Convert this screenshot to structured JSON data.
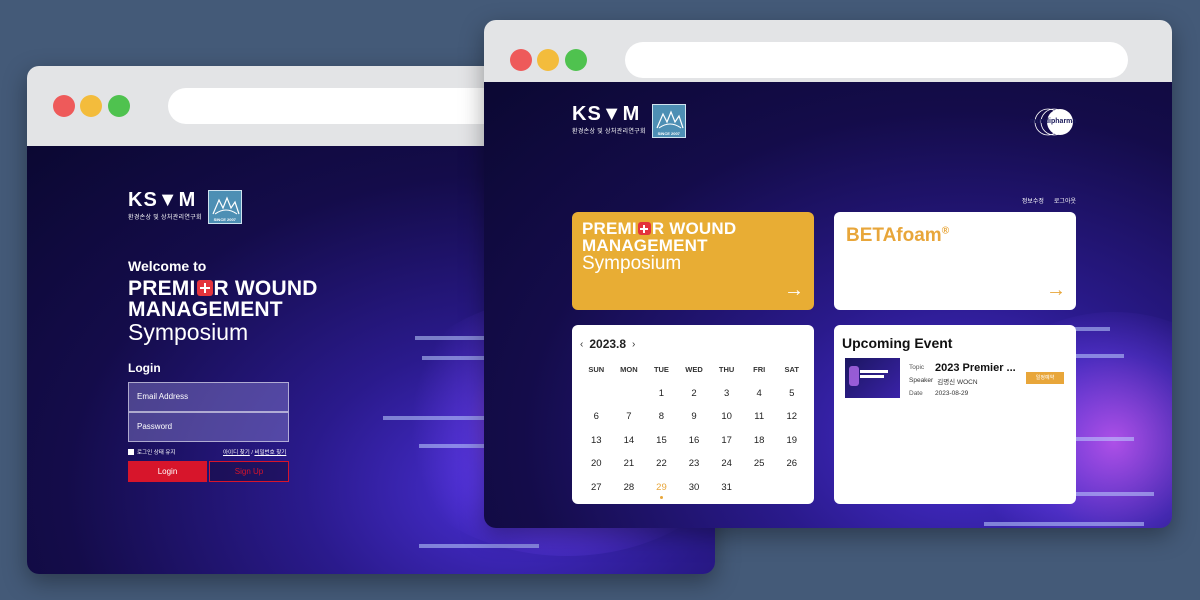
{
  "login_window": {
    "logo": {
      "main": "KS▼M",
      "sub": "환경손상 및 상처관리연구회",
      "badge": "SINCE 2007"
    },
    "welcome": "Welcome to",
    "symposium": {
      "line1a": "PREMI",
      "line1b": "R WOUND",
      "line2": "MANAGEMENT",
      "line3": "Symposium"
    },
    "login_title": "Login",
    "email_placeholder": "Email Address",
    "password_placeholder": "Password",
    "remember_label": "로그인 상태 유지",
    "find_email": "아이디 찾기",
    "find_sep": " / ",
    "find_password": "비밀번호 찾기",
    "login_button": "Login",
    "signup_button": "Sign Up"
  },
  "dashboard_window": {
    "logo": {
      "main": "KS▼M",
      "sub": "환경손상 및 상처관리연구회",
      "badge": "SINCE 2007"
    },
    "brand": "mundipharma",
    "top_links": {
      "edit_profile": "정보수정",
      "logout": "로그아웃"
    },
    "symposium_card": {
      "line1a": "PREMI",
      "line1b": "R WOUND",
      "line2": "MANAGEMENT",
      "line3": "Symposium",
      "arrow": "→"
    },
    "beta_card": {
      "title": "BETAfoam",
      "mark": "®",
      "arrow": "→"
    },
    "calendar": {
      "prev": "‹",
      "month": "2023.8",
      "next": "›",
      "weekdays": [
        "SUN",
        "MON",
        "TUE",
        "WED",
        "THU",
        "FRI",
        "SAT"
      ],
      "weeks": [
        [
          "",
          "",
          "1",
          "2",
          "3",
          "4",
          "5"
        ],
        [
          "6",
          "7",
          "8",
          "9",
          "10",
          "11",
          "12"
        ],
        [
          "13",
          "14",
          "15",
          "16",
          "17",
          "18",
          "19"
        ],
        [
          "20",
          "21",
          "22",
          "23",
          "24",
          "25",
          "26"
        ],
        [
          "27",
          "28",
          "29",
          "30",
          "31",
          "",
          ""
        ]
      ],
      "highlighted_day": "29",
      "highlight_color": "#e8a63a"
    },
    "upcoming_event": {
      "title": "Upcoming Event",
      "topic_label": "Topic",
      "topic": "2023 Premier ...",
      "speaker_label": "Speaker",
      "speaker": "김명신 WOCN",
      "date_label": "Date",
      "date": "2023-08-29",
      "button": "일정예약"
    }
  },
  "colors": {
    "accent_orange": "#e8ad34",
    "login_red": "#d7152b",
    "page_bg": "#445a78"
  }
}
